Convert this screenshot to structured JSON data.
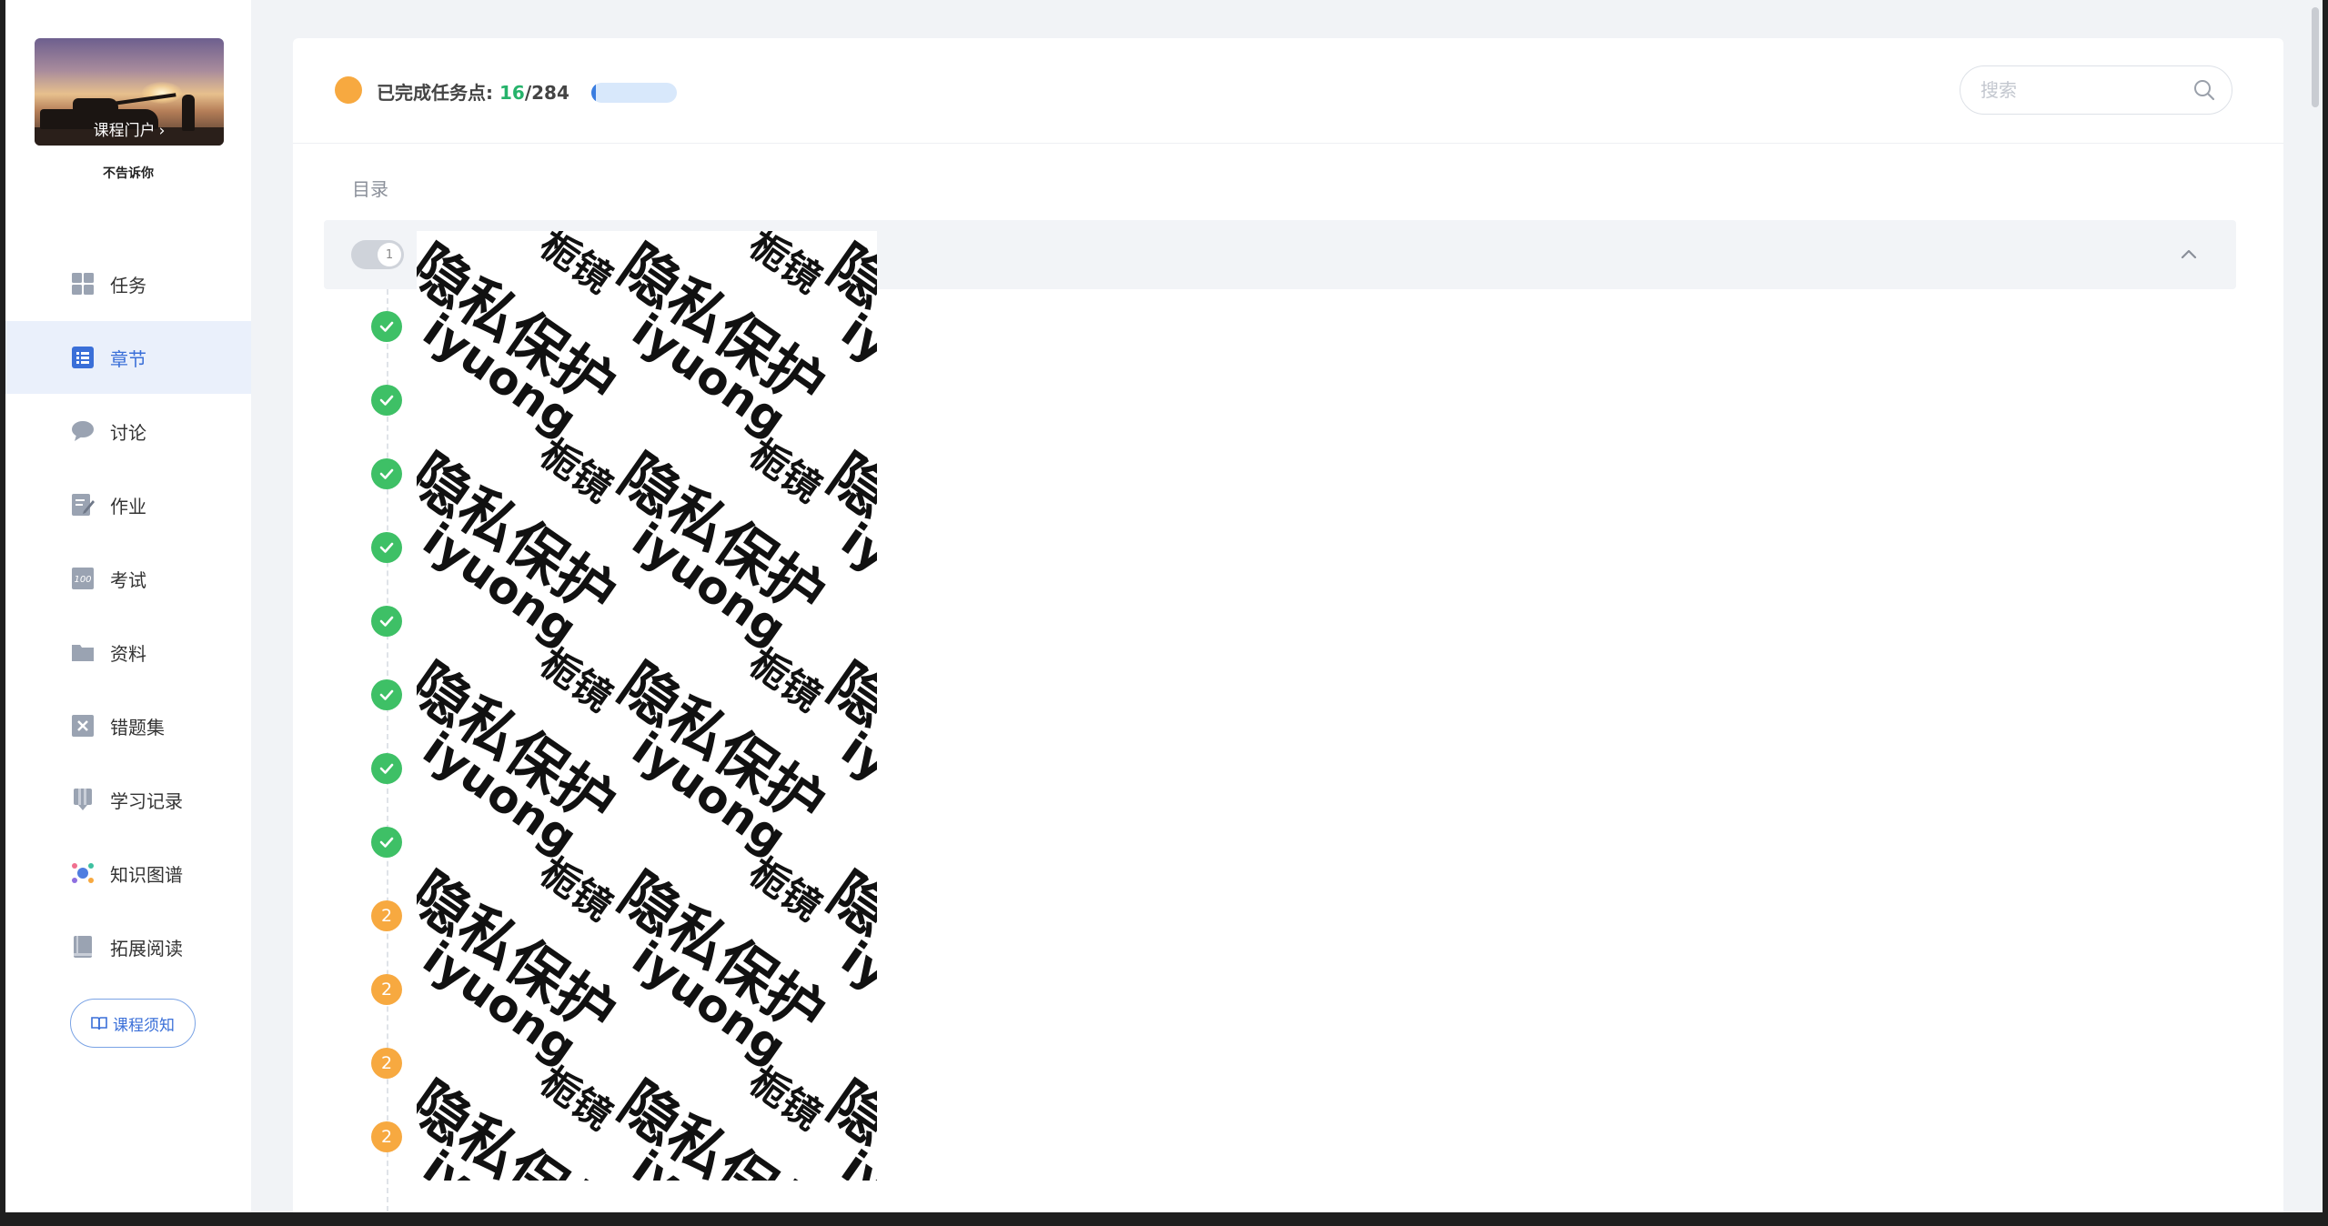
{
  "sidebar": {
    "portal_link": "课程门户",
    "course_name": "不告诉你",
    "nav": [
      {
        "label": "任务",
        "icon": "grid-icon",
        "active": false
      },
      {
        "label": "章节",
        "icon": "list-icon",
        "active": true
      },
      {
        "label": "讨论",
        "icon": "chat-icon",
        "active": false
      },
      {
        "label": "作业",
        "icon": "edit-icon",
        "active": false
      },
      {
        "label": "考试",
        "icon": "exam-icon",
        "active": false
      },
      {
        "label": "资料",
        "icon": "folder-icon",
        "active": false
      },
      {
        "label": "错题集",
        "icon": "error-book-icon",
        "active": false
      },
      {
        "label": "学习记录",
        "icon": "record-icon",
        "active": false
      },
      {
        "label": "知识图谱",
        "icon": "graph-icon",
        "active": false
      },
      {
        "label": "拓展阅读",
        "icon": "book-icon",
        "active": false
      }
    ],
    "notice_button": "课程须知"
  },
  "header": {
    "progress_label": "已完成任务点: ",
    "progress_done": "16",
    "progress_total": "/284",
    "progress_fraction": 0.056,
    "search_placeholder": "搜索"
  },
  "toc": {
    "title": "目录",
    "chapter_number": "1",
    "sections": [
      {
        "status": "done",
        "badge": ""
      },
      {
        "status": "done",
        "badge": ""
      },
      {
        "status": "done",
        "badge": ""
      },
      {
        "status": "done",
        "badge": ""
      },
      {
        "status": "done",
        "badge": ""
      },
      {
        "status": "done",
        "badge": ""
      },
      {
        "status": "done",
        "badge": ""
      },
      {
        "status": "done",
        "badge": ""
      },
      {
        "status": "pending",
        "badge": "2"
      },
      {
        "status": "pending",
        "badge": "2"
      },
      {
        "status": "pending",
        "badge": "2"
      },
      {
        "status": "pending",
        "badge": "2"
      }
    ]
  },
  "watermark": {
    "main": "隐私保护",
    "small": "栀镜",
    "latin": "iyuong"
  },
  "colors": {
    "accent": "#3a6fd8",
    "done": "#3ec066",
    "pending": "#f7a940",
    "progress_count": "#26b36b"
  }
}
